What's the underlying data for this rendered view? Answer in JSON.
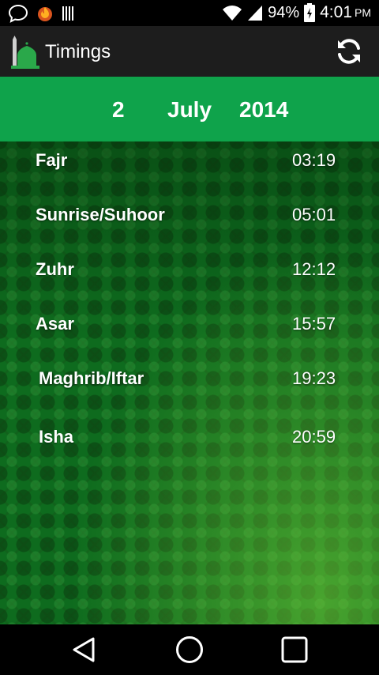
{
  "status_bar": {
    "battery": "94%",
    "time": "4:01",
    "ampm": "PM",
    "icons": [
      "chat-bubble-icon",
      "flame-icon",
      "barcode-icon",
      "wifi-icon",
      "signal-icon",
      "battery-icon"
    ]
  },
  "action_bar": {
    "title": "Timings",
    "refresh_icon": "refresh-icon"
  },
  "date": {
    "day": "2",
    "month": "July",
    "year": "2014"
  },
  "prayers": [
    {
      "name": "Fajr",
      "time": "03:19"
    },
    {
      "name": "Sunrise/Suhoor",
      "time": "05:01"
    },
    {
      "name": "Zuhr",
      "time": "12:12"
    },
    {
      "name": "Asar",
      "time": "15:57"
    },
    {
      "name": "Maghrib/Iftar",
      "time": "19:23"
    },
    {
      "name": "Isha",
      "time": "20:59"
    }
  ],
  "colors": {
    "date_bar": "#0fa34b",
    "action_bar": "#1d1d1d",
    "background_pattern": "#0e6b1e"
  },
  "nav": {
    "back_icon": "back-triangle-icon",
    "home_icon": "home-circle-icon",
    "recents_icon": "recents-square-icon"
  }
}
